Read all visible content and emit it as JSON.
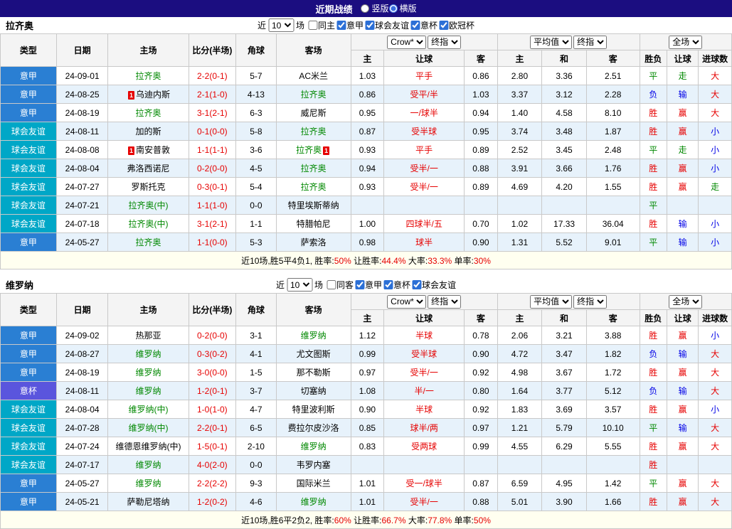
{
  "topbar": {
    "title": "近期战绩",
    "radios": [
      {
        "label": "竖版",
        "selected": false
      },
      {
        "label": "横版",
        "selected": true
      }
    ]
  },
  "colors": {
    "topbar_bg": "#1b0d80",
    "types": {
      "意甲": "#2a7fd3",
      "球会友谊": "#00a7c7",
      "意杯": "#5a55dd"
    },
    "results": {
      "胜": "#e60000",
      "赢": "#e60000",
      "大": "#e60000",
      "负": "#0000e6",
      "输": "#0000e6",
      "小": "#0000e6",
      "平": "#008800",
      "走": "#008800"
    },
    "focus_team": "#008800",
    "score": "#e60000",
    "handicap": "#e60000",
    "alt_row": "#e7f2fb"
  },
  "sections": [
    {
      "team": "拉齐奥",
      "filter": {
        "near": "近",
        "count": "10",
        "games": "场",
        "checkboxes": [
          {
            "label": "同主",
            "checked": false
          },
          {
            "label": "意甲",
            "checked": true
          },
          {
            "label": "球会友谊",
            "checked": true
          },
          {
            "label": "意杯",
            "checked": true
          },
          {
            "label": "欧冠杯",
            "checked": true
          }
        ]
      },
      "table": {
        "static_headers": [
          "类型",
          "日期",
          "主场",
          "比分(半场)",
          "角球",
          "客场"
        ],
        "dropdowns": {
          "odds_source": "Crow*",
          "odds_time": "终指",
          "avg_source": "平均值",
          "avg_time": "终指",
          "scope": "全场"
        },
        "sub_headers": [
          "主",
          "让球",
          "客",
          "主",
          "和",
          "客",
          "胜负",
          "让球",
          "进球数"
        ],
        "rows": [
          {
            "type": "意甲",
            "date": "24-09-01",
            "home": {
              "name": "拉齐奥",
              "focus": true
            },
            "score": "2-2(0-1)",
            "corners": "5-7",
            "away": {
              "name": "AC米兰"
            },
            "odds": [
              "1.03",
              "平手",
              "0.86",
              "2.80",
              "3.36",
              "2.51"
            ],
            "results": [
              "平",
              "走",
              "大"
            ]
          },
          {
            "type": "意甲",
            "date": "24-08-25",
            "home": {
              "name": "乌迪内斯",
              "card": "1"
            },
            "score": "2-1(1-0)",
            "corners": "4-13",
            "away": {
              "name": "拉齐奥",
              "focus": true
            },
            "odds": [
              "0.86",
              "受平/半",
              "1.03",
              "3.37",
              "3.12",
              "2.28"
            ],
            "results": [
              "负",
              "输",
              "大"
            ]
          },
          {
            "type": "意甲",
            "date": "24-08-19",
            "home": {
              "name": "拉齐奥",
              "focus": true
            },
            "score": "3-1(2-1)",
            "corners": "6-3",
            "away": {
              "name": "威尼斯"
            },
            "odds": [
              "0.95",
              "一/球半",
              "0.94",
              "1.40",
              "4.58",
              "8.10"
            ],
            "results": [
              "胜",
              "赢",
              "大"
            ]
          },
          {
            "type": "球会友谊",
            "date": "24-08-11",
            "home": {
              "name": "加的斯"
            },
            "score": "0-1(0-0)",
            "corners": "5-8",
            "away": {
              "name": "拉齐奥",
              "focus": true
            },
            "odds": [
              "0.87",
              "受半球",
              "0.95",
              "3.74",
              "3.48",
              "1.87"
            ],
            "results": [
              "胜",
              "赢",
              "小"
            ]
          },
          {
            "type": "球会友谊",
            "date": "24-08-08",
            "home": {
              "name": "南安普敦",
              "card": "1"
            },
            "score": "1-1(1-1)",
            "corners": "3-6",
            "away": {
              "name": "拉齐奥",
              "focus": true,
              "card": "1"
            },
            "odds": [
              "0.93",
              "平手",
              "0.89",
              "2.52",
              "3.45",
              "2.48"
            ],
            "results": [
              "平",
              "走",
              "小"
            ]
          },
          {
            "type": "球会友谊",
            "date": "24-08-04",
            "home": {
              "name": "弗洛西诺尼"
            },
            "score": "0-2(0-0)",
            "corners": "4-5",
            "away": {
              "name": "拉齐奥",
              "focus": true
            },
            "odds": [
              "0.94",
              "受半/一",
              "0.88",
              "3.91",
              "3.66",
              "1.76"
            ],
            "results": [
              "胜",
              "赢",
              "小"
            ]
          },
          {
            "type": "球会友谊",
            "date": "24-07-27",
            "home": {
              "name": "罗斯托克"
            },
            "score": "0-3(0-1)",
            "corners": "5-4",
            "away": {
              "name": "拉齐奥",
              "focus": true
            },
            "odds": [
              "0.93",
              "受半/一",
              "0.89",
              "4.69",
              "4.20",
              "1.55"
            ],
            "results": [
              "胜",
              "赢",
              "走"
            ]
          },
          {
            "type": "球会友谊",
            "date": "24-07-21",
            "home": {
              "name": "拉齐奥(中)",
              "focus": true
            },
            "score": "1-1(1-0)",
            "corners": "0-0",
            "away": {
              "name": "特里埃斯蒂纳"
            },
            "odds": [
              "",
              "",
              "",
              "",
              "",
              ""
            ],
            "results": [
              "平",
              "",
              ""
            ]
          },
          {
            "type": "球会友谊",
            "date": "24-07-18",
            "home": {
              "name": "拉齐奥(中)",
              "focus": true
            },
            "score": "3-1(2-1)",
            "corners": "1-1",
            "away": {
              "name": "特腊帕尼"
            },
            "odds": [
              "1.00",
              "四球半/五",
              "0.70",
              "1.02",
              "17.33",
              "36.04"
            ],
            "results": [
              "胜",
              "输",
              "小"
            ]
          },
          {
            "type": "意甲",
            "date": "24-05-27",
            "home": {
              "name": "拉齐奥",
              "focus": true
            },
            "score": "1-1(0-0)",
            "corners": "5-3",
            "away": {
              "name": "萨索洛"
            },
            "odds": [
              "0.98",
              "球半",
              "0.90",
              "1.31",
              "5.52",
              "9.01"
            ],
            "results": [
              "平",
              "输",
              "小"
            ]
          }
        ]
      },
      "summary": [
        {
          "t": "近10场,胜5平4负1, 胜率:"
        },
        {
          "t": "50%",
          "c": "#e60000"
        },
        {
          "t": " 让胜率:"
        },
        {
          "t": "44.4%",
          "c": "#e60000"
        },
        {
          "t": " 大率:"
        },
        {
          "t": "33.3%",
          "c": "#e60000"
        },
        {
          "t": " 单率:"
        },
        {
          "t": "30%",
          "c": "#e60000"
        }
      ]
    },
    {
      "team": "维罗纳",
      "filter": {
        "near": "近",
        "count": "10",
        "games": "场",
        "checkboxes": [
          {
            "label": "同客",
            "checked": false
          },
          {
            "label": "意甲",
            "checked": true
          },
          {
            "label": "意杯",
            "checked": true
          },
          {
            "label": "球会友谊",
            "checked": true
          }
        ]
      },
      "table": {
        "static_headers": [
          "类型",
          "日期",
          "主场",
          "比分(半场)",
          "角球",
          "客场"
        ],
        "dropdowns": {
          "odds_source": "Crow*",
          "odds_time": "终指",
          "avg_source": "平均值",
          "avg_time": "终指",
          "scope": "全场"
        },
        "sub_headers": [
          "主",
          "让球",
          "客",
          "主",
          "和",
          "客",
          "胜负",
          "让球",
          "进球数"
        ],
        "rows": [
          {
            "type": "意甲",
            "date": "24-09-02",
            "home": {
              "name": "热那亚"
            },
            "score": "0-2(0-0)",
            "corners": "3-1",
            "away": {
              "name": "维罗纳",
              "focus": true
            },
            "odds": [
              "1.12",
              "半球",
              "0.78",
              "2.06",
              "3.21",
              "3.88"
            ],
            "results": [
              "胜",
              "赢",
              "小"
            ]
          },
          {
            "type": "意甲",
            "date": "24-08-27",
            "home": {
              "name": "维罗纳",
              "focus": true
            },
            "score": "0-3(0-2)",
            "corners": "4-1",
            "away": {
              "name": "尤文图斯"
            },
            "odds": [
              "0.99",
              "受半球",
              "0.90",
              "4.72",
              "3.47",
              "1.82"
            ],
            "results": [
              "负",
              "输",
              "大"
            ]
          },
          {
            "type": "意甲",
            "date": "24-08-19",
            "home": {
              "name": "维罗纳",
              "focus": true
            },
            "score": "3-0(0-0)",
            "corners": "1-5",
            "away": {
              "name": "那不勒斯"
            },
            "odds": [
              "0.97",
              "受半/一",
              "0.92",
              "4.98",
              "3.67",
              "1.72"
            ],
            "results": [
              "胜",
              "赢",
              "大"
            ]
          },
          {
            "type": "意杯",
            "date": "24-08-11",
            "home": {
              "name": "维罗纳",
              "focus": true
            },
            "score": "1-2(0-1)",
            "corners": "3-7",
            "away": {
              "name": "切塞纳"
            },
            "odds": [
              "1.08",
              "半/一",
              "0.80",
              "1.64",
              "3.77",
              "5.12"
            ],
            "results": [
              "负",
              "输",
              "大"
            ]
          },
          {
            "type": "球会友谊",
            "date": "24-08-04",
            "home": {
              "name": "维罗纳(中)",
              "focus": true
            },
            "score": "1-0(1-0)",
            "corners": "4-7",
            "away": {
              "name": "特里波利斯"
            },
            "odds": [
              "0.90",
              "半球",
              "0.92",
              "1.83",
              "3.69",
              "3.57"
            ],
            "results": [
              "胜",
              "赢",
              "小"
            ]
          },
          {
            "type": "球会友谊",
            "date": "24-07-28",
            "home": {
              "name": "维罗纳(中)",
              "focus": true
            },
            "score": "2-2(0-1)",
            "corners": "6-5",
            "away": {
              "name": "费拉尔皮沙洛"
            },
            "odds": [
              "0.85",
              "球半/两",
              "0.97",
              "1.21",
              "5.79",
              "10.10"
            ],
            "results": [
              "平",
              "输",
              "大"
            ]
          },
          {
            "type": "球会友谊",
            "date": "24-07-24",
            "home": {
              "name": "维德恩维罗纳(中)"
            },
            "score": "1-5(0-1)",
            "corners": "2-10",
            "away": {
              "name": "维罗纳",
              "focus": true
            },
            "odds": [
              "0.83",
              "受两球",
              "0.99",
              "4.55",
              "6.29",
              "5.55"
            ],
            "results": [
              "胜",
              "赢",
              "大"
            ]
          },
          {
            "type": "球会友谊",
            "date": "24-07-17",
            "home": {
              "name": "维罗纳",
              "focus": true
            },
            "score": "4-0(2-0)",
            "corners": "0-0",
            "away": {
              "name": "韦罗内塞"
            },
            "odds": [
              "",
              "",
              "",
              "",
              "",
              ""
            ],
            "results": [
              "胜",
              "",
              ""
            ]
          },
          {
            "type": "意甲",
            "date": "24-05-27",
            "home": {
              "name": "维罗纳",
              "focus": true
            },
            "score": "2-2(2-2)",
            "corners": "9-3",
            "away": {
              "name": "国际米兰"
            },
            "odds": [
              "1.01",
              "受一/球半",
              "0.87",
              "6.59",
              "4.95",
              "1.42"
            ],
            "results": [
              "平",
              "赢",
              "大"
            ]
          },
          {
            "type": "意甲",
            "date": "24-05-21",
            "home": {
              "name": "萨勒尼塔纳"
            },
            "score": "1-2(0-2)",
            "corners": "4-6",
            "away": {
              "name": "维罗纳",
              "focus": true
            },
            "odds": [
              "1.01",
              "受半/一",
              "0.88",
              "5.01",
              "3.90",
              "1.66"
            ],
            "results": [
              "胜",
              "赢",
              "大"
            ]
          }
        ]
      },
      "summary": [
        {
          "t": "近10场,胜6平2负2, 胜率:"
        },
        {
          "t": "60%",
          "c": "#e60000"
        },
        {
          "t": " 让胜率:"
        },
        {
          "t": "66.7%",
          "c": "#e60000"
        },
        {
          "t": " 大率:"
        },
        {
          "t": "77.8%",
          "c": "#e60000"
        },
        {
          "t": " 单率:"
        },
        {
          "t": "50%",
          "c": "#e60000"
        }
      ]
    }
  ]
}
